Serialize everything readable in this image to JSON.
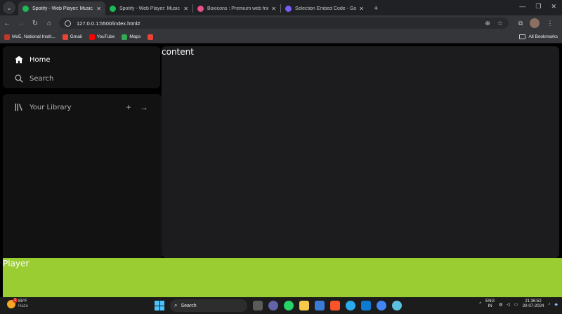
{
  "browser": {
    "tabs": [
      {
        "title": "Spotify - Web Player: Music for",
        "active": true,
        "favicon_color": "#1db954"
      },
      {
        "title": "Spotify - Web Player: Music for",
        "active": false,
        "favicon_color": "#1db954"
      },
      {
        "title": "Boxicons : Premium web friendly",
        "active": false,
        "favicon_color": "#e94f8a"
      },
      {
        "title": "Selection Embed Code - Google",
        "active": false,
        "favicon_color": "#7b5bf5"
      }
    ],
    "url": "127.0.0.1:5500/index.html#",
    "bookmarks": [
      {
        "label": "MoE, National Instit...",
        "color": "#c0392b"
      },
      {
        "label": "Gmail",
        "color": "#ea4335"
      },
      {
        "label": "YouTube",
        "color": "#ff0000"
      },
      {
        "label": "Maps",
        "color": "#34a853"
      },
      {
        "label": "",
        "color": "#ea4335"
      }
    ],
    "all_bookmarks": "All Bookmarks"
  },
  "sidebar": {
    "home_label": "Home",
    "search_label": "Search",
    "library_label": "Your Library"
  },
  "content": {
    "title": "content"
  },
  "player": {
    "label": "Player",
    "color": "#9acd32"
  },
  "taskbar": {
    "weather_temp": "85°F",
    "weather_desc": "Haze",
    "weather_badge": "1",
    "search_label": "Search",
    "lang_top": "ENG",
    "lang_bottom": "IN",
    "time": "21:36:52",
    "date": "30-07-2024"
  }
}
